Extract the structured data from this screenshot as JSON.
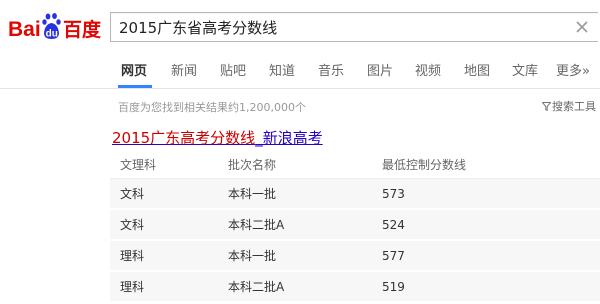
{
  "header": {
    "logo": {
      "text_bai": "Bai",
      "text_du": "du",
      "text_cn": "百度",
      "brand_red": "#e10601",
      "brand_blue": "#2932e1"
    },
    "search": {
      "value": "2015广东省高考分数线",
      "clear_icon": "close-icon"
    }
  },
  "tabs": [
    {
      "label": "网页",
      "active": true
    },
    {
      "label": "新闻"
    },
    {
      "label": "贴吧"
    },
    {
      "label": "知道"
    },
    {
      "label": "音乐"
    },
    {
      "label": "图片"
    },
    {
      "label": "视频"
    },
    {
      "label": "地图"
    },
    {
      "label": "文库"
    },
    {
      "label": "更多»"
    }
  ],
  "accent_color": "#3385ff",
  "results": {
    "count_text": "百度为您找到相关结果约1,200,000个",
    "tools_label": "搜索工具",
    "tools_icon": "filter-icon"
  },
  "result": {
    "title_highlight": "2015广东高考分数线",
    "title_rest": "_新浪高考",
    "table": {
      "headers": [
        "文理科",
        "批次名称",
        "最低控制分数线"
      ],
      "rows": [
        [
          "文科",
          "本科一批",
          "573"
        ],
        [
          "文科",
          "本科二批A",
          "524"
        ],
        [
          "理科",
          "本科一批",
          "577"
        ],
        [
          "理科",
          "本科二批A",
          "519"
        ]
      ]
    }
  }
}
